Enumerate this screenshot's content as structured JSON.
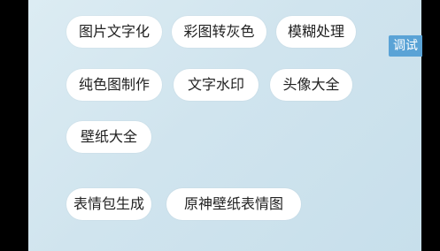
{
  "menu": {
    "row1": [
      "图片文字化",
      "彩图转灰色",
      "模糊处理"
    ],
    "row2": [
      "纯色图制作",
      "文字水印",
      "头像大全"
    ],
    "row3": [
      "壁纸大全"
    ],
    "row4": [
      "表情包生成",
      "原神壁纸表情图"
    ]
  },
  "debug_label": "调试",
  "colors": {
    "background": "#d0e4ee",
    "chip": "#ffffff",
    "debug": "#5aa3d6"
  }
}
